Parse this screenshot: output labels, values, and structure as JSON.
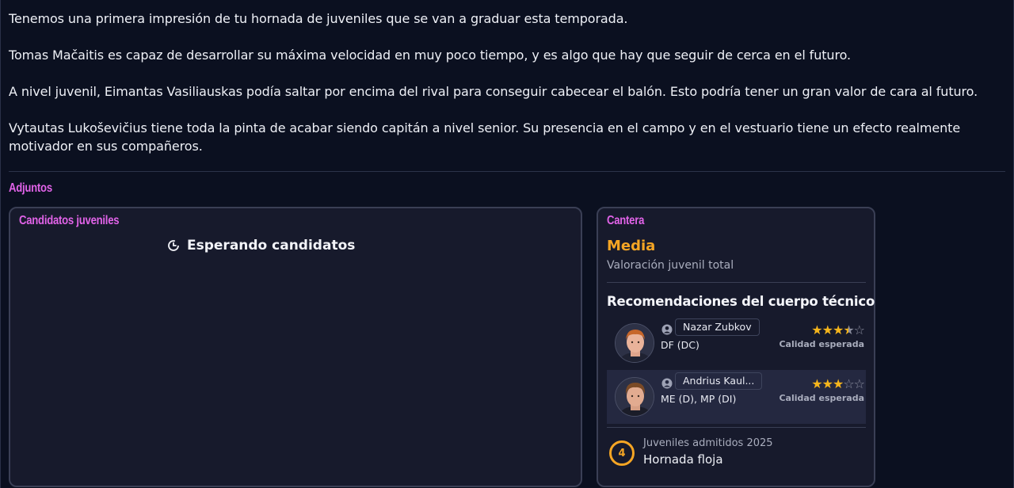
{
  "message": {
    "paragraphs": [
      "Tenemos una primera impresión de tu hornada de juveniles que se van a graduar esta temporada.",
      "Tomas Mačaitis es capaz de desarrollar su máxima velocidad en muy poco tiempo, y es algo que hay que seguir de cerca en el futuro.",
      "A nivel juvenil, Eimantas Vasiliauskas podía saltar por encima del rival para conseguir cabecear el balón. Esto podría tener un gran valor de cara al futuro.",
      "Vytautas Lukoševičius tiene toda la pinta de acabar siendo capitán a nivel senior. Su presencia en el campo y en el vestuario tiene un efecto realmente motivador en sus compañeros."
    ]
  },
  "attachments": {
    "title": "Adjuntos"
  },
  "candidates_card": {
    "title": "Candidatos juveniles",
    "status_icon": "clock-icon",
    "status_text": "Esperando candidatos"
  },
  "academy_card": {
    "title": "Cantera",
    "rating": "Media",
    "rating_label": "Valoración juvenil total",
    "recommendations_title": "Recomendaciones del cuerpo técnico",
    "players": [
      {
        "name": "Nazar Zubkov",
        "positions": "DF (DC)",
        "stars": 3.5,
        "quality_label": "Calidad esperada"
      },
      {
        "name": "Andrius Kaul...",
        "positions": "ME (D), MP (DI)",
        "stars": 3,
        "quality_label": "Calidad esperada"
      }
    ],
    "intake": {
      "count": "4",
      "label": "Juveniles admitidos 2025",
      "value": "Hornada floja"
    }
  },
  "colors": {
    "background": "#0b1020",
    "card": "#171a2c",
    "accent_pink": "#e163e8",
    "accent_orange": "#f5a524",
    "star": "#f5b51c"
  }
}
